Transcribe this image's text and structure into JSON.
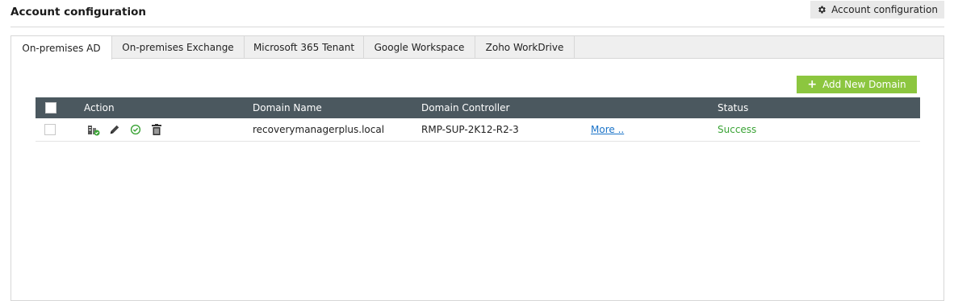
{
  "header": {
    "title": "Account configuration",
    "config_button_label": "Account configuration",
    "config_button_icon": "gear-icon"
  },
  "tabs": [
    {
      "label": "On-premises AD",
      "active": true
    },
    {
      "label": "On-premises Exchange",
      "active": false
    },
    {
      "label": "Microsoft 365 Tenant",
      "active": false
    },
    {
      "label": "Google Workspace",
      "active": false
    },
    {
      "label": "Zoho WorkDrive",
      "active": false
    }
  ],
  "toolbar": {
    "add_domain_label": "Add New Domain",
    "add_domain_icon": "plus-icon"
  },
  "table": {
    "columns": [
      "Action",
      "Domain Name",
      "Domain Controller",
      "Status"
    ],
    "rows": [
      {
        "checked": false,
        "actions": [
          "domain-settings-icon",
          "edit-icon",
          "check-circle-icon",
          "delete-icon"
        ],
        "domain_name": "recoverymanagerplus.local",
        "domain_controller": "RMP-SUP-2K12-R2-3",
        "more": "More ..",
        "status": "Success"
      }
    ]
  },
  "colors": {
    "header_bg": "#4b585f",
    "accent_green": "#8cc63f",
    "status_success": "#3aa335",
    "link": "#1a73c8"
  }
}
